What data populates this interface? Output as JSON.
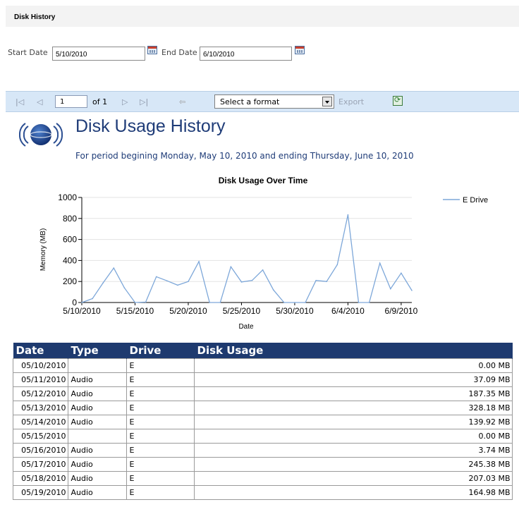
{
  "window_title": "Disk History",
  "params": {
    "start_label": "Start Date",
    "start_value": "5/10/2010",
    "end_label": "End Date",
    "end_value": "6/10/2010"
  },
  "toolbar": {
    "first_page": "|◁",
    "prev_page": "◁",
    "page_value": "1",
    "of_label": "of 1",
    "next_page": "▷",
    "last_page": "▷|",
    "back": "⇦",
    "format_selected": "Select a format",
    "export_label": "Export"
  },
  "report": {
    "title": "Disk Usage History",
    "subtitle": "For period begining Monday, May 10, 2010 and ending Thursday, June 10, 2010"
  },
  "chart_data": {
    "type": "line",
    "title": "Disk Usage Over Time",
    "xlabel": "Date",
    "ylabel": "Memory (MB)",
    "ylim": [
      0,
      1000
    ],
    "yticks": [
      0,
      200,
      400,
      600,
      800,
      1000
    ],
    "xtick_labels": [
      "5/10/2010",
      "5/15/2010",
      "5/20/2010",
      "5/25/2010",
      "5/30/2010",
      "6/4/2010",
      "6/9/2010"
    ],
    "legend_position": "top-right",
    "series": [
      {
        "name": "E Drive",
        "color": "#7da7d9",
        "x": [
          "5/10/2010",
          "5/11/2010",
          "5/12/2010",
          "5/13/2010",
          "5/14/2010",
          "5/15/2010",
          "5/16/2010",
          "5/17/2010",
          "5/18/2010",
          "5/19/2010",
          "5/20/2010",
          "5/21/2010",
          "5/22/2010",
          "5/23/2010",
          "5/24/2010",
          "5/25/2010",
          "5/26/2010",
          "5/27/2010",
          "5/28/2010",
          "5/29/2010",
          "5/30/2010",
          "5/31/2010",
          "6/1/2010",
          "6/2/2010",
          "6/3/2010",
          "6/4/2010",
          "6/5/2010",
          "6/6/2010",
          "6/7/2010",
          "6/8/2010",
          "6/9/2010",
          "6/10/2010"
        ],
        "values": [
          0,
          37.09,
          187.35,
          328.18,
          139.92,
          0,
          3.74,
          245.38,
          207.03,
          164.98,
          200,
          390,
          0,
          0,
          340,
          195,
          210,
          310,
          120,
          0,
          0,
          0,
          210,
          200,
          360,
          835,
          0,
          0,
          375,
          130,
          280,
          115
        ]
      }
    ]
  },
  "table": {
    "headers": [
      "Date",
      "Type",
      "Drive",
      "Disk Usage"
    ],
    "rows": [
      [
        "05/10/2010",
        "",
        "E",
        "0.00 MB"
      ],
      [
        "05/11/2010",
        "Audio",
        "E",
        "37.09 MB"
      ],
      [
        "05/12/2010",
        "Audio",
        "E",
        "187.35 MB"
      ],
      [
        "05/13/2010",
        "Audio",
        "E",
        "328.18 MB"
      ],
      [
        "05/14/2010",
        "Audio",
        "E",
        "139.92 MB"
      ],
      [
        "05/15/2010",
        "",
        "E",
        "0.00 MB"
      ],
      [
        "05/16/2010",
        "Audio",
        "E",
        "3.74 MB"
      ],
      [
        "05/17/2010",
        "Audio",
        "E",
        "245.38 MB"
      ],
      [
        "05/18/2010",
        "Audio",
        "E",
        "207.03 MB"
      ],
      [
        "05/19/2010",
        "Audio",
        "E",
        "164.98 MB"
      ]
    ]
  }
}
